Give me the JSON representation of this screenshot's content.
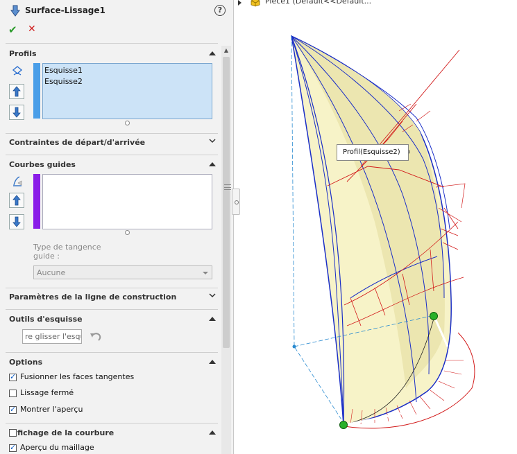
{
  "property_manager": {
    "title": "Surface-Lissage1",
    "help_glyph": "?",
    "ok_glyph": "✔",
    "cancel_glyph": "✕"
  },
  "sections": {
    "profils": {
      "title": "Profils",
      "items": [
        "Esquisse1",
        "Esquisse2"
      ]
    },
    "contraintes": {
      "title": "Contraintes de départ/d'arrivée"
    },
    "courbes_guides": {
      "title": "Courbes guides",
      "tangency_label": "Type de tangence guide :",
      "tangency_value": "Aucune"
    },
    "parametres": {
      "title": "Paramètres de la ligne de construction"
    },
    "outils": {
      "title": "Outils d'esquisse",
      "drag_button": "re glisser l'esqu"
    },
    "options": {
      "title": "Options",
      "checkboxes": [
        {
          "label": "Fusionner les faces tangentes",
          "checked": true
        },
        {
          "label": "Lissage fermé",
          "checked": false
        },
        {
          "label": "Montrer l'aperçu",
          "checked": true
        }
      ]
    },
    "courbure": {
      "title": "fichage de la courbure",
      "checked": false,
      "mesh_label": "Aperçu du maillage",
      "mesh_checked": true
    }
  },
  "viewport": {
    "tree_label": "Pièce1  (Défault<<Défault...",
    "tooltip": "Profil(Esquisse2)"
  },
  "colors": {
    "profil_bar": "#4a9ee8",
    "guide_bar": "#8a1de8",
    "surface_fill": "#f7f3c8",
    "profile_curve": "#1a2ec7",
    "mesh_line": "#d21a1a",
    "handle_green": "#29b029"
  }
}
